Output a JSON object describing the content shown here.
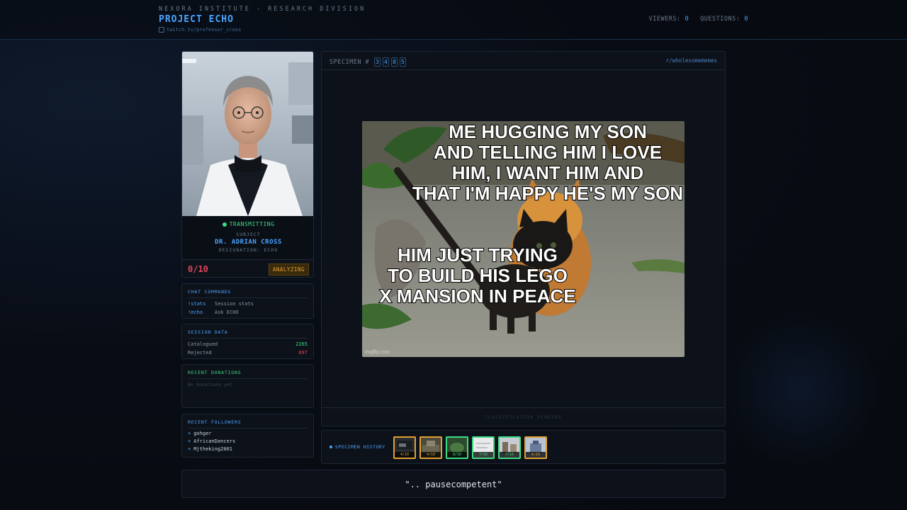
{
  "header": {
    "org": "NEXORA INSTITUTE - RESEARCH DIVISION",
    "project": "PROJECT ECHO",
    "url": "twitch.tv/professor_cross",
    "viewers_label": "VIEWERS:",
    "viewers": "0",
    "questions_label": "QUESTIONS:",
    "questions": "0"
  },
  "subject": {
    "status": "TRANSMITTING",
    "label": "SUBJECT",
    "name": "DR. ADRIAN CROSS",
    "designation": "DESIGNATION: ECHO",
    "score": "0/10",
    "state": "ANALYZING"
  },
  "commands": {
    "title": "CHAT COMMANDS",
    "items": [
      {
        "key": "!stats",
        "desc": "Session stats"
      },
      {
        "key": "!echo",
        "desc": "Ask ECHO"
      }
    ]
  },
  "session": {
    "title": "SESSION DATA",
    "catalogued_label": "Catalogued",
    "catalogued": "2265",
    "rejected_label": "Rejected",
    "rejected": "697"
  },
  "donations": {
    "title": "RECENT DONATIONS",
    "empty": "No donations yet"
  },
  "followers": {
    "title": "RECENT FOLLOWERS",
    "items": [
      "gohger",
      "AfricanDancers",
      "Mjtheking2001"
    ]
  },
  "specimen": {
    "label": "SPECIMEN #",
    "digits": [
      "3",
      "4",
      "8",
      "5"
    ],
    "subreddit": "r/wholesomememes",
    "meme_top": [
      "ME HUGGING MY SON",
      "AND TELLING HIM I LOVE",
      "HIM, I WANT HIM AND",
      "THAT I'M HAPPY HE'S MY SON"
    ],
    "meme_bottom": [
      "HIM JUST TRYING",
      "TO BUILD HIS LEGO",
      "X MANSION IN PEACE"
    ],
    "watermark": "imgflip.com",
    "footer": "CLASSIFICATION PENDING"
  },
  "history": {
    "label": "SPECIMEN HISTORY",
    "items": [
      {
        "score": "4/10",
        "tier": "amber"
      },
      {
        "score": "4/10",
        "tier": "amber"
      },
      {
        "score": "8/10",
        "tier": "green"
      },
      {
        "score": "7/10",
        "tier": "green"
      },
      {
        "score": "7/10",
        "tier": "green"
      },
      {
        "score": "6/10",
        "tier": "amber"
      }
    ]
  },
  "quote": "\".. pausecompetent\""
}
